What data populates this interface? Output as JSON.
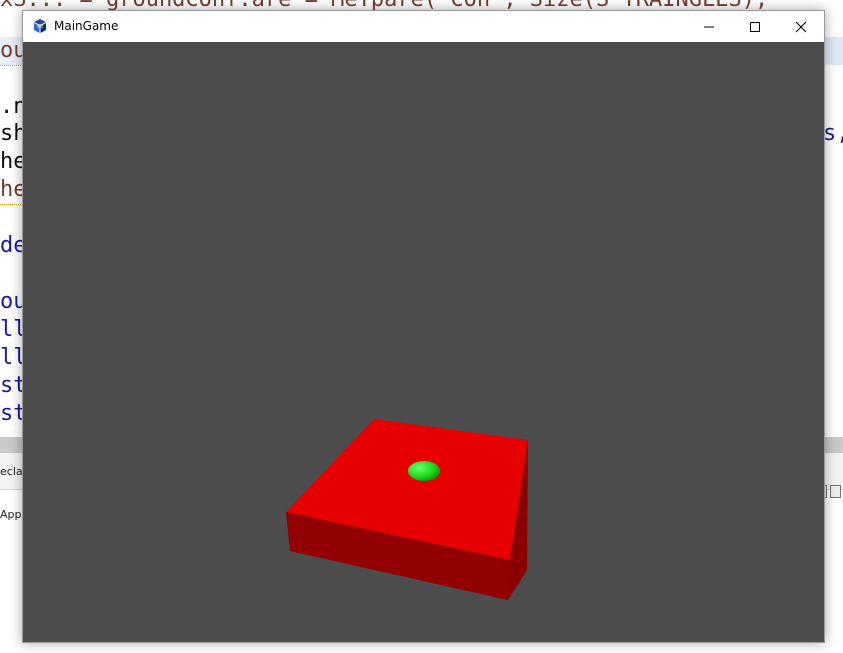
{
  "background_editor": {
    "top_line": "xS... = groundConf.are = MeTpare('Con', Size(S_TRAINGLES);",
    "lines": [
      {
        "text": "ou",
        "color": "#7a3b2e"
      },
      {
        "text": ".n",
        "color": "#111111"
      },
      {
        "text": "sh",
        "color": "#111111"
      },
      {
        "text": "he",
        "color": "#111111"
      },
      {
        "text": "he",
        "color": "#7a3b2e"
      },
      {
        "text": "de",
        "color": "#1a1aa6"
      },
      {
        "text": "ou",
        "color": "#1a1aa6"
      },
      {
        "text": "ll",
        "color": "#1a1aa6"
      },
      {
        "text": "ll",
        "color": "#1a1aa6"
      },
      {
        "text": "st",
        "color": "#1a1aa6"
      },
      {
        "text": "st",
        "color": "#1a1aa6"
      }
    ],
    "right_fragment": "s,",
    "panel_tab_label": "ecla",
    "panel_row_label": "App"
  },
  "window": {
    "title": "MainGame",
    "icon": "java-app-icon",
    "controls": [
      "minimize-icon",
      "maximize-icon",
      "close-icon"
    ]
  },
  "scene": {
    "background_color": "#4d4d4d",
    "box_top_color": "#e60000",
    "box_left_color": "#c00000",
    "box_front_color": "#8a0000",
    "ball_color": "#22dd22"
  }
}
